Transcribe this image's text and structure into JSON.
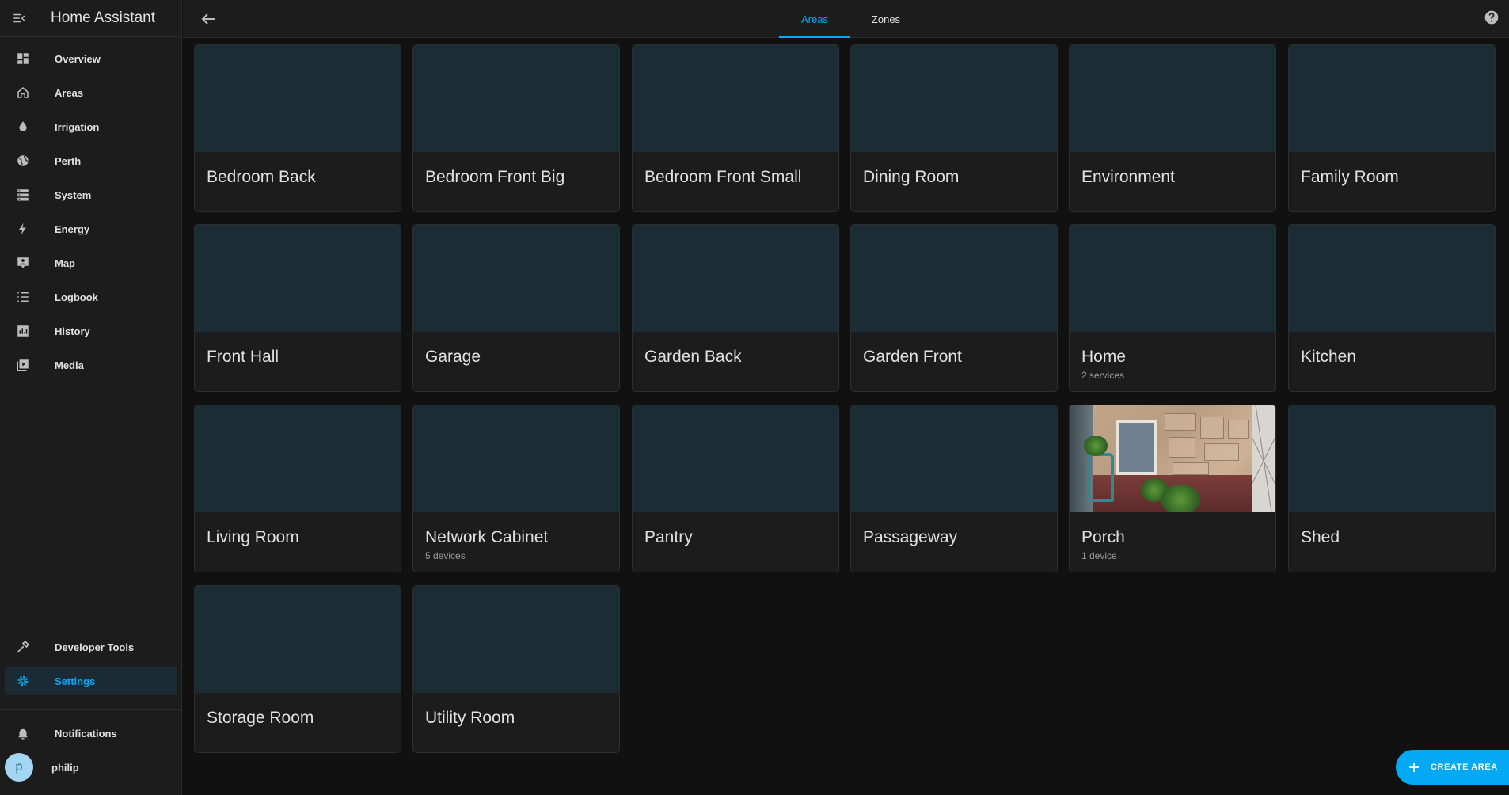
{
  "sidebar": {
    "title": "Home Assistant",
    "items": [
      {
        "label": "Overview",
        "icon": "dashboard-icon"
      },
      {
        "label": "Areas",
        "icon": "home-icon"
      },
      {
        "label": "Irrigation",
        "icon": "water-drop-icon"
      },
      {
        "label": "Perth",
        "icon": "globe-icon"
      },
      {
        "label": "System",
        "icon": "server-icon"
      },
      {
        "label": "Energy",
        "icon": "lightning-icon"
      },
      {
        "label": "Map",
        "icon": "map-marker-icon"
      },
      {
        "label": "Logbook",
        "icon": "list-icon"
      },
      {
        "label": "History",
        "icon": "chart-bar-icon"
      },
      {
        "label": "Media",
        "icon": "play-box-icon"
      }
    ],
    "bottom": {
      "developer_tools": "Developer Tools",
      "settings": "Settings",
      "notifications": "Notifications",
      "user": "philip",
      "avatar_letter": "p"
    }
  },
  "topbar": {
    "tabs": [
      {
        "label": "Areas",
        "active": true
      },
      {
        "label": "Zones",
        "active": false
      }
    ]
  },
  "areas": [
    {
      "name": "Bedroom Back",
      "sub": ""
    },
    {
      "name": "Bedroom Front Big",
      "sub": ""
    },
    {
      "name": "Bedroom Front Small",
      "sub": ""
    },
    {
      "name": "Dining Room",
      "sub": ""
    },
    {
      "name": "Environment",
      "sub": ""
    },
    {
      "name": "Family Room",
      "sub": ""
    },
    {
      "name": "Front Hall",
      "sub": ""
    },
    {
      "name": "Garage",
      "sub": ""
    },
    {
      "name": "Garden Back",
      "sub": ""
    },
    {
      "name": "Garden Front",
      "sub": ""
    },
    {
      "name": "Home",
      "sub": "2 services"
    },
    {
      "name": "Kitchen",
      "sub": ""
    },
    {
      "name": "Living Room",
      "sub": ""
    },
    {
      "name": "Network Cabinet",
      "sub": "5 devices"
    },
    {
      "name": "Pantry",
      "sub": ""
    },
    {
      "name": "Passageway",
      "sub": ""
    },
    {
      "name": "Porch",
      "sub": "1 device",
      "has_photo": true
    },
    {
      "name": "Shed",
      "sub": ""
    },
    {
      "name": "Storage Room",
      "sub": ""
    },
    {
      "name": "Utility Room",
      "sub": ""
    }
  ],
  "fab": {
    "label": "CREATE AREA"
  },
  "colors": {
    "accent": "#03a9f4",
    "card_placeholder": "#1c2c35",
    "background": "#111111"
  }
}
